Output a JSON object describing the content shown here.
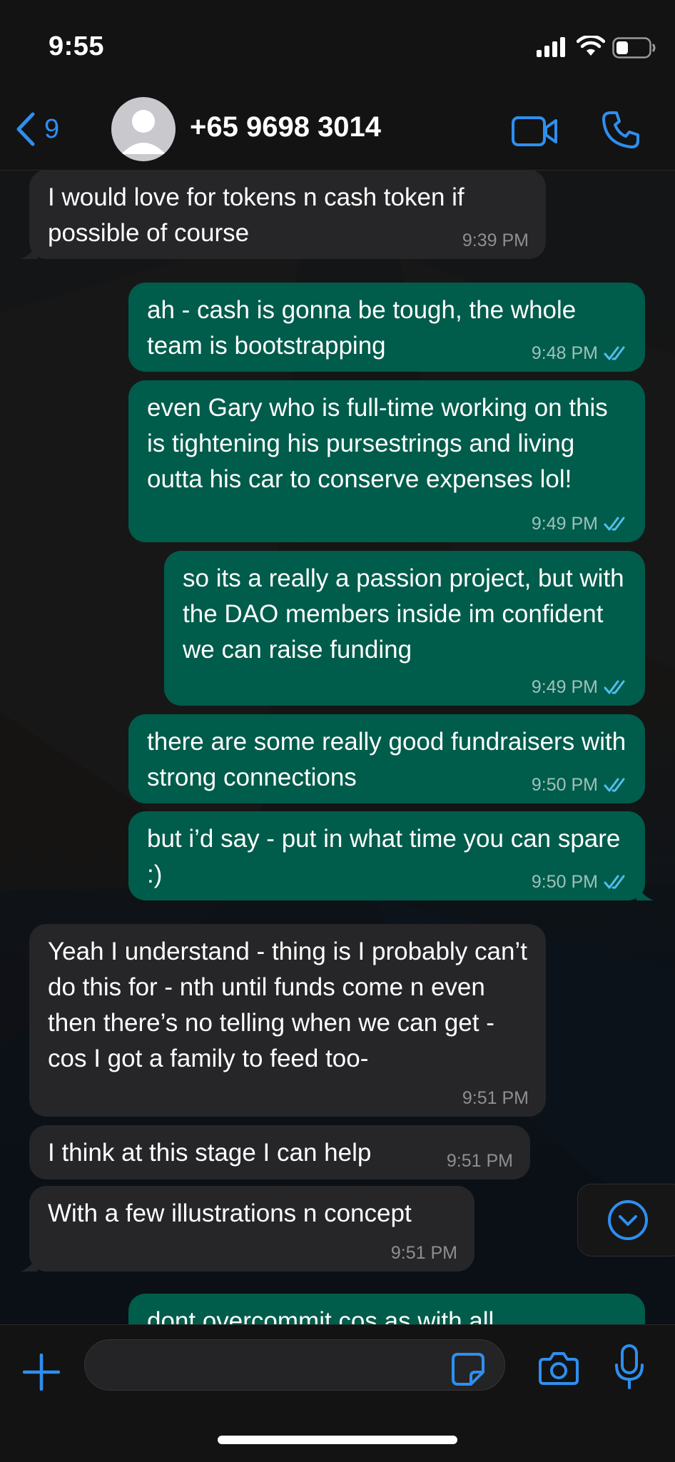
{
  "status_bar": {
    "time": "9:55"
  },
  "header": {
    "back_count": "9",
    "contact": "+65 9698 3014"
  },
  "messages": [
    {
      "dir": "in",
      "text": "I would love for tokens n cash token if possible of course",
      "time": "9:39 PM"
    },
    {
      "dir": "out",
      "text": "ah - cash is gonna be tough, the whole team is bootstrapping",
      "time": "9:48 PM"
    },
    {
      "dir": "out",
      "text": "even Gary who is full-time working on this is tightening his pursestrings and living outta his car to conserve expenses lol!",
      "time": "9:49 PM"
    },
    {
      "dir": "out",
      "text": "so its a really a passion project, but with the DAO members inside im confident we can raise funding",
      "time": "9:49 PM"
    },
    {
      "dir": "out",
      "text": "there are some really good fundraisers with strong connections",
      "time": "9:50 PM"
    },
    {
      "dir": "out",
      "text": "but i’d say - put in what time you can spare :)",
      "time": "9:50 PM"
    },
    {
      "dir": "in",
      "text": "Yeah I understand - thing is I probably can’t do this for - nth until funds come n even then there’s no telling when we can get - cos I got a family to feed too-",
      "time": "9:51 PM"
    },
    {
      "dir": "in",
      "text": "I think at this stage I can help",
      "time": "9:51 PM"
    },
    {
      "dir": "in",
      "text": "With a few illustrations n concept",
      "time": "9:51 PM"
    },
    {
      "dir": "out",
      "text": "dont overcommit cos as with all",
      "time": ""
    }
  ],
  "composer": {
    "placeholder": ""
  },
  "colors": {
    "accent": "#2e8ff0",
    "outgoing": "#005c4b",
    "incoming": "#262628",
    "read_ticks": "#53bdeb"
  },
  "icons": [
    "back-chevron-icon",
    "avatar-icon",
    "video-call-icon",
    "phone-call-icon",
    "plus-icon",
    "sticker-icon",
    "camera-icon",
    "microphone-icon",
    "scroll-down-icon",
    "double-check-icon"
  ]
}
